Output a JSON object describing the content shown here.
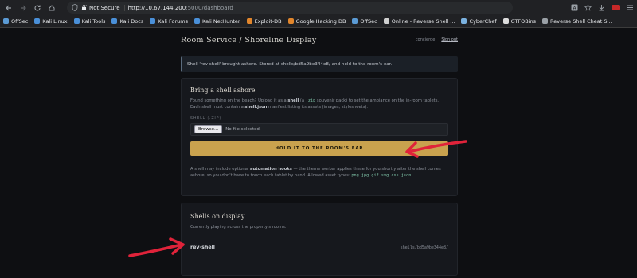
{
  "browser": {
    "not_secure": "Not Secure",
    "url_host": "http://10.67.144.200",
    "url_path": ":5000/dashboard"
  },
  "bookmarks": [
    {
      "label": "OffSec",
      "icon": "offsec-icon",
      "color": "#5b9bd5"
    },
    {
      "label": "Kali Linux",
      "icon": "kali-icon",
      "color": "#4a90d9"
    },
    {
      "label": "Kali Tools",
      "icon": "kali-icon",
      "color": "#4a90d9"
    },
    {
      "label": "Kali Docs",
      "icon": "kali-icon",
      "color": "#4a90d9"
    },
    {
      "label": "Kali Forums",
      "icon": "kali-icon",
      "color": "#4a90d9"
    },
    {
      "label": "Kali NetHunter",
      "icon": "kali-icon",
      "color": "#4a90d9"
    },
    {
      "label": "Exploit-DB",
      "icon": "exploitdb-icon",
      "color": "#e2862c"
    },
    {
      "label": "Google Hacking DB",
      "icon": "ghdb-icon",
      "color": "#e2862c"
    },
    {
      "label": "OffSec",
      "icon": "offsec-icon",
      "color": "#5b9bd5"
    },
    {
      "label": "Online - Reverse Shell ...",
      "icon": "skull-icon",
      "color": "#cfcfcf"
    },
    {
      "label": "CyberChef",
      "icon": "cyberchef-icon",
      "color": "#7bb2e0"
    },
    {
      "label": "GTFOBins",
      "icon": "gtfobins-icon",
      "color": "#dddddd"
    },
    {
      "label": "Reverse Shell Cheat S...",
      "icon": "globe-icon",
      "color": "#9aa0a6"
    }
  ],
  "header": {
    "title": "Room Service / Shoreline Display",
    "concierge": "concierge",
    "sign_out": "Sign out"
  },
  "alert": {
    "message": "Shell 'rev-shell' brought ashore. Stored at shells/bd5a9be344e8/ and held to the room's ear."
  },
  "upload": {
    "heading": "Bring a shell ashore",
    "desc_1": "Found something on the beach? Upload it as a ",
    "desc_shell": "shell",
    "desc_2": " (a ",
    "desc_zip": ".zip",
    "desc_3": " souvenir pack) to set the ambiance on the in-room tablets. Each shell must contain a ",
    "desc_json": "shell.json",
    "desc_4": " manifest listing its assets (images, stylesheets).",
    "field_label": "SHELL (.ZIP)",
    "browse_label": "Browse...",
    "no_file": "No file selected.",
    "submit_label": "HOLD IT TO THE ROOM'S EAR",
    "hooks_1": "A shell may include optional ",
    "hooks_bold": "automation hooks",
    "hooks_2": " — the theme worker applies these for you shortly after the shell comes ashore, so you don't have to touch each tablet by hand. Allowed asset types: ",
    "hooks_types": "png jpg gif svg css json",
    "hooks_end": "."
  },
  "display": {
    "heading": "Shells on display",
    "subtitle": "Currently playing across the property's rooms.",
    "shells": [
      {
        "name": "rev-shell",
        "path": "shells/bd5a9be344e8/"
      }
    ]
  },
  "colors": {
    "accent": "#c9a24e",
    "arrow": "#e0233a"
  }
}
